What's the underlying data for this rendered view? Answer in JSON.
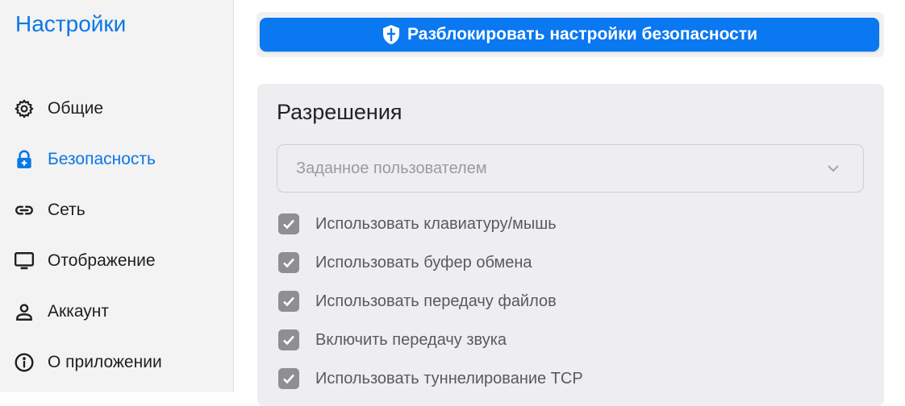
{
  "sidebar": {
    "title": "Настройки",
    "items": [
      {
        "label": "Общие",
        "icon": "gear-icon"
      },
      {
        "label": "Безопасность",
        "icon": "lock-icon",
        "active": true
      },
      {
        "label": "Сеть",
        "icon": "link-icon"
      },
      {
        "label": "Отображение",
        "icon": "monitor-icon"
      },
      {
        "label": "Аккаунт",
        "icon": "person-icon"
      },
      {
        "label": "О приложении",
        "icon": "info-icon"
      }
    ]
  },
  "main": {
    "unlock_button": {
      "label": "Разблокировать настройки безопасности",
      "icon": "shield-icon"
    },
    "permissions": {
      "title": "Разрешения",
      "mode_select": {
        "value": "Заданное пользователем"
      },
      "options": [
        {
          "label": "Использовать клавиатуру/мышь",
          "checked": true
        },
        {
          "label": "Использовать буфер обмена",
          "checked": true
        },
        {
          "label": "Использовать передачу файлов",
          "checked": true
        },
        {
          "label": "Включить передачу звука",
          "checked": true
        },
        {
          "label": "Использовать туннелирование TCP",
          "checked": true
        }
      ]
    }
  },
  "colors": {
    "accent": "#0a78e6",
    "button": "#0a78f0",
    "checkbox_disabled": "#8e8e93",
    "sidebar_bg": "#f3f3f3",
    "card_bg": "#eeeef1"
  }
}
